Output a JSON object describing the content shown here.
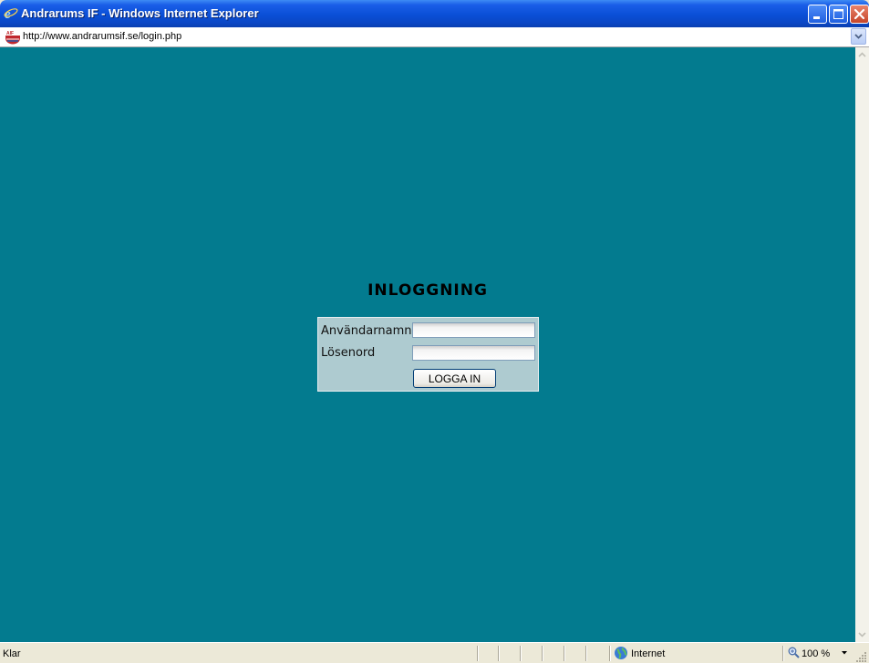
{
  "window": {
    "title": "Andrarums IF - Windows Internet Explorer"
  },
  "address_bar": {
    "url": "http://www.andrarumsif.se/login.php",
    "favicon_text": "AIF"
  },
  "login": {
    "heading": "INLOGGNING",
    "username_label": "Användarnamn",
    "username_value": "",
    "password_label": "Lösenord",
    "password_value": "",
    "submit_label": "LOGGA IN"
  },
  "status_bar": {
    "status": "Klar",
    "zone": "Internet",
    "zoom": "100 %"
  },
  "colors": {
    "page_background": "#037b8f",
    "login_box": "#aecbd0",
    "titlebar": "#0a4fd6"
  },
  "icons": {
    "title": "ie-logo-icon",
    "favicon": "site-favicon-icon",
    "minimize": "minimize-icon",
    "maximize": "maximize-icon",
    "close": "close-icon",
    "zone": "globe-icon",
    "zoom": "magnifier-icon"
  }
}
